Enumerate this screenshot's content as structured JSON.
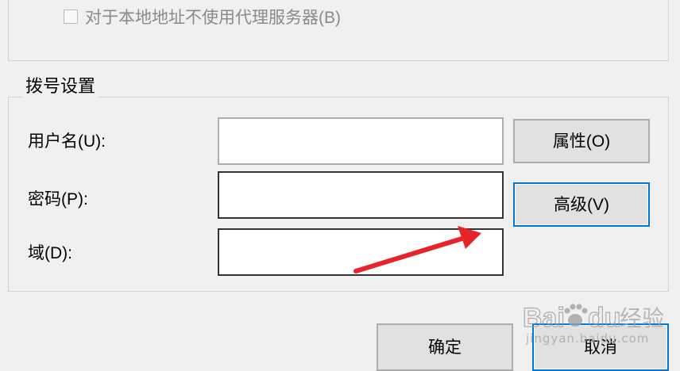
{
  "proxy_section": {
    "bypass_local_label": "对于本地地址不使用代理服务器(B)",
    "bypass_local_checked": false
  },
  "dial_section": {
    "legend": "拨号设置",
    "username_label": "用户名(U):",
    "username_value": "",
    "password_label": "密码(P):",
    "password_value": "",
    "domain_label": "域(D):",
    "domain_value": "",
    "properties_label": "属性(O)",
    "advanced_label": "高级(V)"
  },
  "footer": {
    "ok_label": "确定",
    "cancel_label": "取消"
  },
  "annotation": {
    "arrow_color": "#e8242b"
  },
  "watermark": {
    "text": "Baidu经验",
    "sub": "jingyan.baidu.com"
  },
  "colors": {
    "focus_border": "#0078d7",
    "button_face": "#e1e1e1",
    "dialog_bg": "#f0f0f0"
  }
}
